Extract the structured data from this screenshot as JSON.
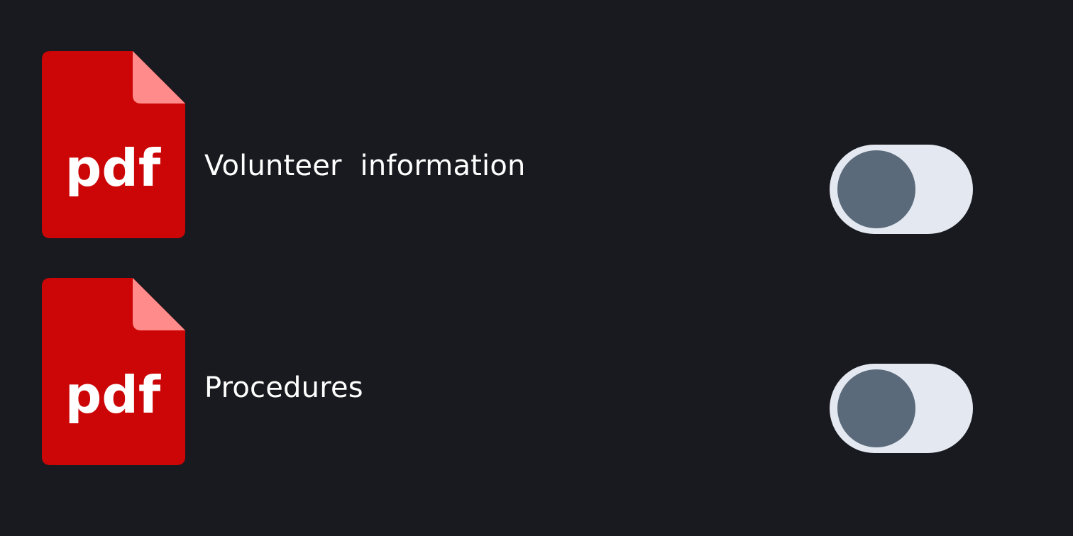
{
  "colors": {
    "background": "#191a1f",
    "pdf_body": "#cc0607",
    "pdf_fold": "#ff8c8a",
    "pdf_text": "#ffffff",
    "title_text": "#ffffff",
    "toggle_track": "#e4e9f1",
    "toggle_knob": "#5b6a7a"
  },
  "documents": [
    {
      "icon": "pdf-file-icon",
      "icon_label": "pdf",
      "title": "Volunteer  information",
      "toggle_on": false
    },
    {
      "icon": "pdf-file-icon",
      "icon_label": "pdf",
      "title": "Procedures",
      "toggle_on": false
    }
  ]
}
